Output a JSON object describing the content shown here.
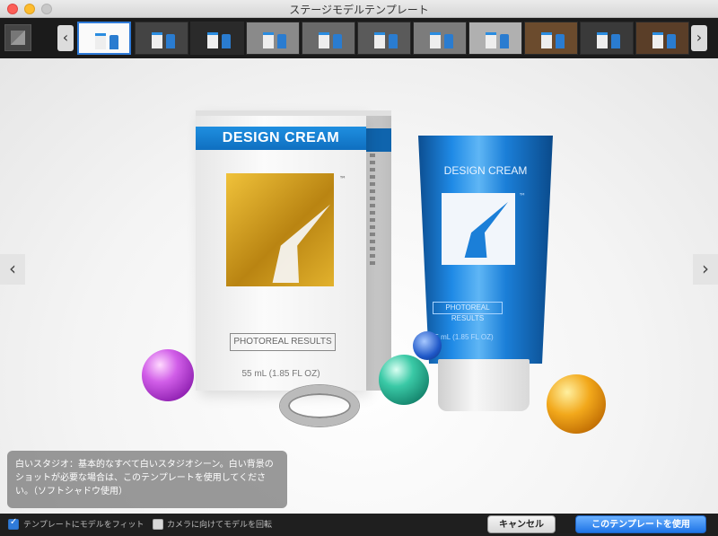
{
  "window": {
    "title": "ステージモデルテンプレート"
  },
  "strip": {
    "prev_label": "‹",
    "next_label": "›",
    "thumbnail_count": 11,
    "selected_index": 0
  },
  "stage": {
    "nav_prev_label": "‹",
    "nav_next_label": "›",
    "box": {
      "band_text": "DESIGN CREAM",
      "tm": "™",
      "photoreal": "PHOTOREAL RESULTS",
      "volume": "55 mL (1.85 FL OZ)"
    },
    "tube": {
      "title": "DESIGN CREAM",
      "tm": "™",
      "photoreal": "PHOTOREAL RESULTS",
      "volume": "55 mL (1.85 FL OZ)"
    }
  },
  "description": {
    "text": "白いスタジオ：基本的なすべて白いスタジオシーン。白い背景のショットが必要な場合は、このテンプレートを使用してください。（ソフトシャドウ使用）"
  },
  "footer": {
    "fit_label": "テンプレートにモデルをフィット",
    "fit_checked": true,
    "rotate_label": "カメラに向けてモデルを回転",
    "rotate_checked": false,
    "cancel_label": "キャンセル",
    "use_label": "このテンプレートを使用"
  }
}
